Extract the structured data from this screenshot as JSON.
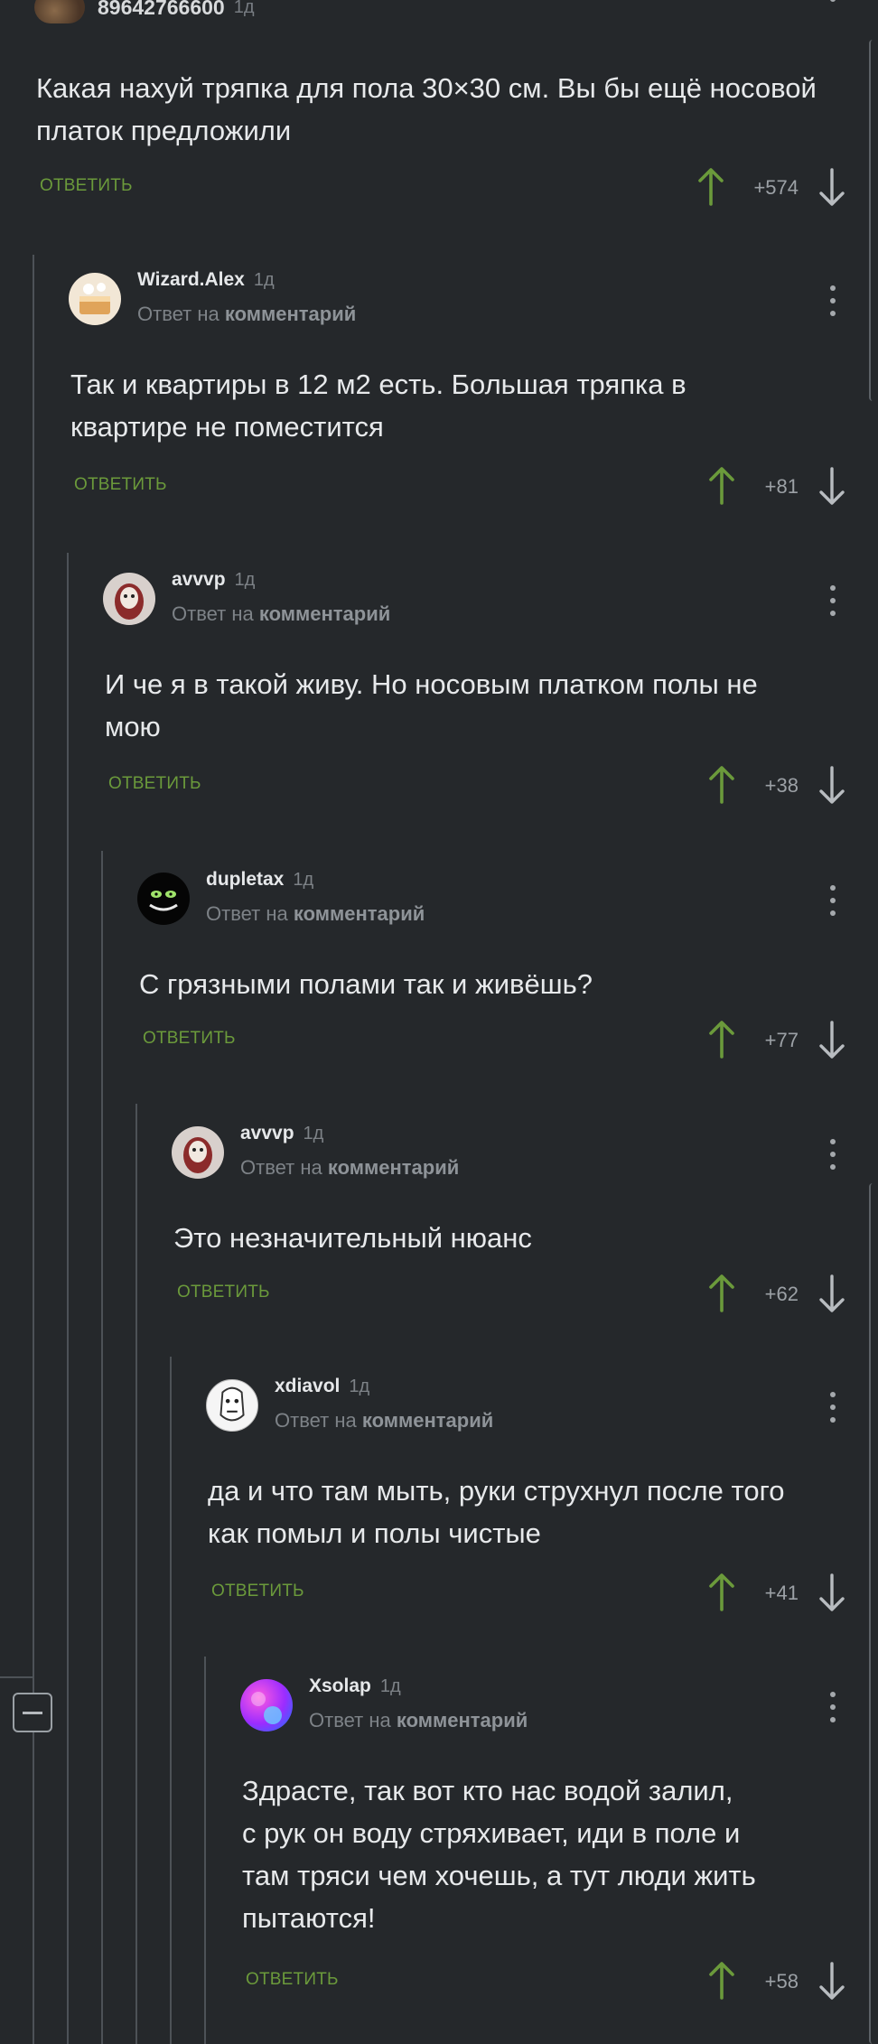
{
  "top_comment": {
    "username": "89642766600",
    "time": "1д",
    "text": "Какая нахуй тряпка для пола 30×30 см. Вы бы ещё носовой платок предложили",
    "reply_label": "ОТВЕТИТЬ",
    "score": "+574"
  },
  "comments": [
    {
      "username": "Wizard.Alex",
      "time": "1д",
      "reply_prefix": "Ответ на",
      "reply_target": "комментарий",
      "text_lines": [
        "Так и квартиры в 12 м2 есть. Большая тряпка в",
        "квартире не поместится"
      ],
      "reply_label": "ОТВЕТИТЬ",
      "score": "+81",
      "avatar_icon": "cake-avatar"
    },
    {
      "username": "avvvp",
      "time": "1д",
      "reply_prefix": "Ответ на",
      "reply_target": "комментарий",
      "text_lines": [
        "И че я в такой живу. Но носовым платком полы не",
        "мою"
      ],
      "reply_label": "ОТВЕТИТЬ",
      "score": "+38",
      "avatar_icon": "face-avatar"
    },
    {
      "username": "dupletax",
      "time": "1д",
      "reply_prefix": "Ответ на",
      "reply_target": "комментарий",
      "text_lines": [
        "С грязными полами так и живёшь?"
      ],
      "reply_label": "ОТВЕТИТЬ",
      "score": "+77",
      "avatar_icon": "cheshire-cat-avatar"
    },
    {
      "username": "avvvp",
      "time": "1д",
      "reply_prefix": "Ответ на",
      "reply_target": "комментарий",
      "text_lines": [
        "Это незначительный нюанс"
      ],
      "reply_label": "ОТВЕТИТЬ",
      "score": "+62",
      "avatar_icon": "face-avatar"
    },
    {
      "username": "xdiavol",
      "time": "1д",
      "reply_prefix": "Ответ на",
      "reply_target": "комментарий",
      "text_lines": [
        "да и что там мыть, руки струхнул после того",
        "как помыл и полы чистые"
      ],
      "reply_label": "ОТВЕТИТЬ",
      "score": "+41",
      "avatar_icon": "sketch-face-avatar"
    },
    {
      "username": "Xsolap",
      "time": "1д",
      "reply_prefix": "Ответ на",
      "reply_target": "комментарий",
      "text_lines": [
        "Здрасте, так вот кто нас водой залил,",
        "с рук он воду стряхивает, иди в поле и",
        "там тряси чем хочешь, а тут люди жить",
        "пытаются!"
      ],
      "reply_label": "ОТВЕТИТЬ",
      "score": "+58",
      "avatar_icon": "neon-avatar"
    }
  ],
  "colors": {
    "background": "#25282b",
    "reply_green": "#6b9a3b",
    "upvote_green": "#6b9a3b",
    "thread_line": "#4d5257"
  }
}
